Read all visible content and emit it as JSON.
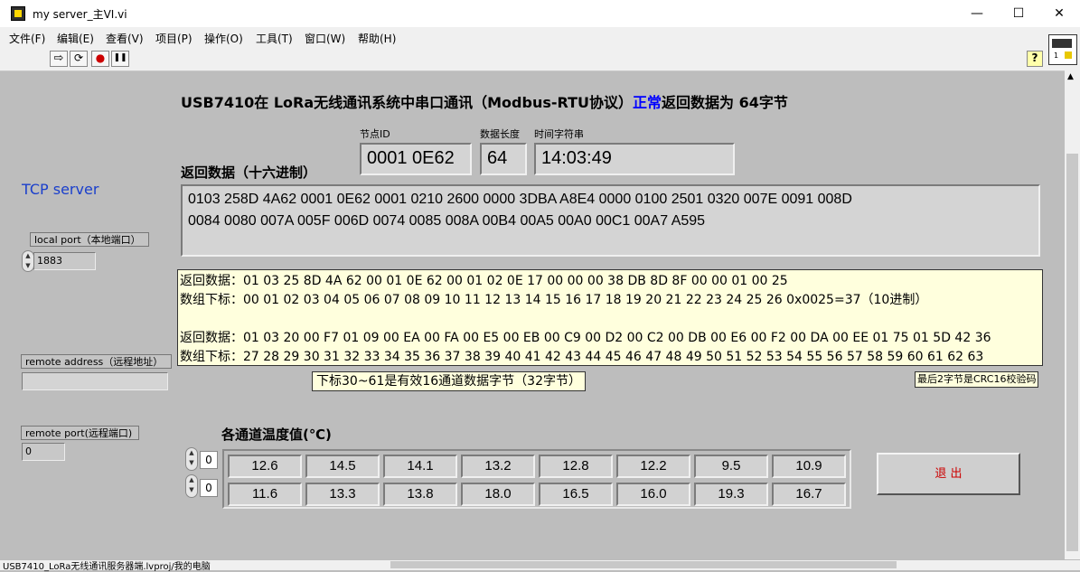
{
  "window": {
    "title": "my server_主VI.vi",
    "minimize": "—",
    "maximize": "☐",
    "close": "✕"
  },
  "menu": [
    "文件(F)",
    "编辑(E)",
    "查看(V)",
    "项目(P)",
    "操作(O)",
    "工具(T)",
    "窗口(W)",
    "帮助(H)"
  ],
  "toolbar": {
    "run": "⇨",
    "run_continuous": "⟳",
    "abort": "●",
    "pause": "❚❚",
    "help": "?"
  },
  "heading": {
    "prefix": "USB7410在 LoRa无线通讯系统中串口通讯（Modbus-RTU协议）",
    "status": "正常",
    "suffix": "返回数据为 64字节",
    "status_color": "#0000ff"
  },
  "node": {
    "id_label": "节点ID",
    "id_value": "0001 0E62",
    "len_label": "数据长度",
    "len_value": "64",
    "time_label": "时间字符串",
    "time_value": "14:03:49"
  },
  "return_data": {
    "label": "返回数据（十六进制）",
    "line1": "0103 258D 4A62 0001 0E62 0001 0210 2600 0000 3DBA A8E4 0000 0100 2501 0320 007E 0091 008D",
    "line2": "0084 0080 007A 005F 006D 0074 0085 008A 00B4 00A5 00A0 00C1 00A7 A595"
  },
  "tcp": {
    "title": "TCP server",
    "title_color": "#1a3fcc",
    "local_port_label": "local port（本地端口）",
    "local_port_value": "1883",
    "remote_address_label": "remote address（远程地址）",
    "remote_address_value": "",
    "remote_port_label": "remote port(远程端口)",
    "remote_port_value": "0"
  },
  "notes": {
    "l1": "返回数据：01 03 25 8D 4A 62 00 01 0E 62 00 01 02 0E 17 00 00 00 38 DB 8D 8F 00 00 01 00 25",
    "l2": "数组下标：00 01 02 03  04 05 06 07 08 09 10 11 12 13 14 15 16 17 18 19  20 21 22 23 24 25 26  0x0025=37（10进制）",
    "l3": "返回数据：01 03 20 00 F7 01 09 00 EA 00 FA 00 E5 00 EB 00 C9 00 D2 00 C2 00 DB 00 E6 00 F2 00 DA 00 EE 01 75 01 5D 42 36",
    "l4": "数组下标：27 28 29 30 31 32 33 34 35 36 37 38 39  40 41 42 43 44 45  46 47 48 49  50 51 52 53 54 55  56 57 58 59 60  61 62 63",
    "bg": "#ffffdd"
  },
  "valid_note": "下标30~61是有效16通道数据字节（32字节）",
  "crc_note": "最后2字节是CRC16校验码",
  "temps": {
    "label": "各通道温度值(℃)",
    "row_index": "0",
    "col_index": "0",
    "row1": [
      "12.6",
      "14.5",
      "14.1",
      "13.2",
      "12.8",
      "12.2",
      "9.5",
      "10.9"
    ],
    "row2": [
      "11.6",
      "13.3",
      "13.8",
      "18.0",
      "16.5",
      "16.0",
      "19.3",
      "16.7"
    ]
  },
  "exit_button": {
    "label": "退 出",
    "color": "#cc0000"
  },
  "status_bar": {
    "path": "USB7410_LoRa无线通讯服务器端.lvproj/我的电脑"
  }
}
